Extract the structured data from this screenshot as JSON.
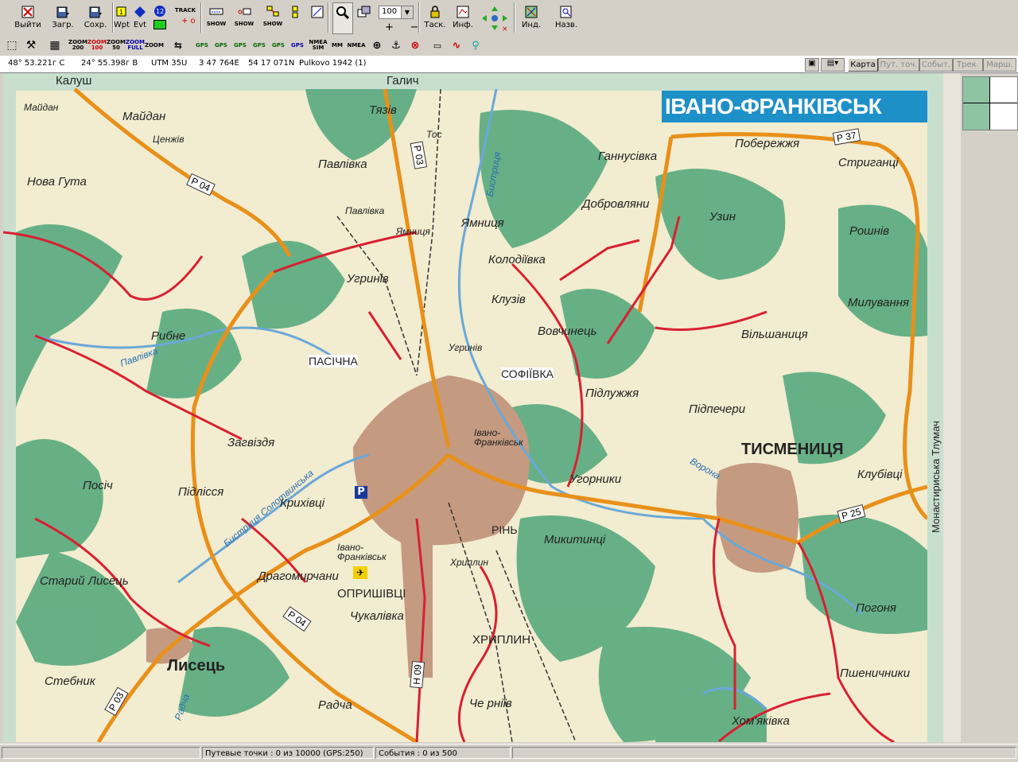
{
  "toolbar1": {
    "exit": "Выйти",
    "load": "Загр.",
    "save": "Сохр.",
    "wpt": "Wpt",
    "evt": "Evt",
    "track": "TRACK",
    "show": "SHOW",
    "zoom_value": "100",
    "task": "Таск.",
    "info": "Инф.",
    "ind": "Инд.",
    "names": "Назв."
  },
  "toolbar2": {
    "zoom200": "ZOOM 200",
    "zoom100": "ZOOM 100",
    "zoom50": "ZOOM 50",
    "zoomfull": "ZOOM FULL",
    "zoom": "ZOOM",
    "gps": "GPS",
    "nmea_sim": "NMEA SIM",
    "mm": "MM",
    "nmea": "NMEA"
  },
  "coordbar": {
    "lat": "48° 53.221г С",
    "lon": "24° 55.398г В",
    "utm": "UTM  35U",
    "easting": "3 47 764E",
    "northing": "54 17 071N",
    "datum": "Pulkovo 1942 (1)"
  },
  "tabs": [
    "Карта",
    "Пут. точ.",
    "Событ.",
    "Трек.",
    "Марш."
  ],
  "map": {
    "title": "ІВАНО-ФРАНКІВСЬК",
    "labels": {
      "kalush": "Калуш",
      "halych": "Галич",
      "maidan_s": "Майдан",
      "maidan": "Майдан",
      "tiaziv": "Тязів",
      "tos": "Тос",
      "tsenzhiv": "Ценжів",
      "nova_huta": "Нова Гута",
      "pavlivka": "Павлівка",
      "pavlivka2": "Павлівка",
      "yamnytsia": "Ямниця",
      "yamnytsia2": "Ямниця",
      "hannusivka": "Ганнусівка",
      "poberezhzhia": "Побережжя",
      "stryhantsi": "Стриганці",
      "dobrovliany": "Добровляни",
      "uzyn": "Узин",
      "roshniv": "Рошнів",
      "kolodiivka": "Колодіївка",
      "uhryniv": "Угринів",
      "uhryniv2": "Угринів",
      "kluziv": "Клузів",
      "milovannia": "Милування",
      "rybne": "Рибне",
      "vovchynets": "Вовчинець",
      "vilshanytsia": "Вільшаниця",
      "pasichna": "ПАСІЧНА",
      "sofiivka": "СОФІЇВКА",
      "pidluzhzhia": "Підлужжя",
      "pidpecheri": "Підпечери",
      "tysmenytsia": "ТИСМЕНИЦЯ",
      "zahvizdia": "Загвіздя",
      "if_city": "Івано-Франківськ",
      "uhornyky": "Угорники",
      "klubivtsi": "Клубівці",
      "posich": "Посіч",
      "pidlissia": "Підлісся",
      "kryhivtsi": "Крихівці",
      "rin": "РІНЬ",
      "mykytyntsi": "Микитинці",
      "staryi_lysets": "Старий Лисець",
      "drahomyrchany": "Драгомирчани",
      "if_airport": "Івано-Франківськ",
      "khryplyn": "Хриплин",
      "opryshivtsi": "ОПРИШІВЦІ",
      "chukalivka": "Чукалівка",
      "khryplyn2": "ХРИПЛИН",
      "pohonia": "Погоня",
      "lysets": "Лисець",
      "stebnyk": "Стебник",
      "pshenychnyky": "Пшеничники",
      "radcha": "Радча",
      "cherniiv": "Че рніїв",
      "khomiakivka": "Хом'яківка",
      "bystrytsia": "Бистриця",
      "pavlivka_river": "Павлівка",
      "vorona": "Ворона",
      "bystrytsia_solot": "Бистриця Солотвинська",
      "radcha_river": "Радча",
      "monastyrska": "Монастириська Тлумач"
    },
    "roads": {
      "p04": "Р 04",
      "p04b": "Р 04",
      "p03": "Р 03",
      "p03b": "Р 03",
      "p37": "Р 37",
      "p25": "Р 25",
      "h09": "Н 09"
    }
  },
  "status": {
    "waypoints": "Путевые точки : 0 из 10000  (GPS:250)",
    "events": "События : 0 из 500"
  }
}
